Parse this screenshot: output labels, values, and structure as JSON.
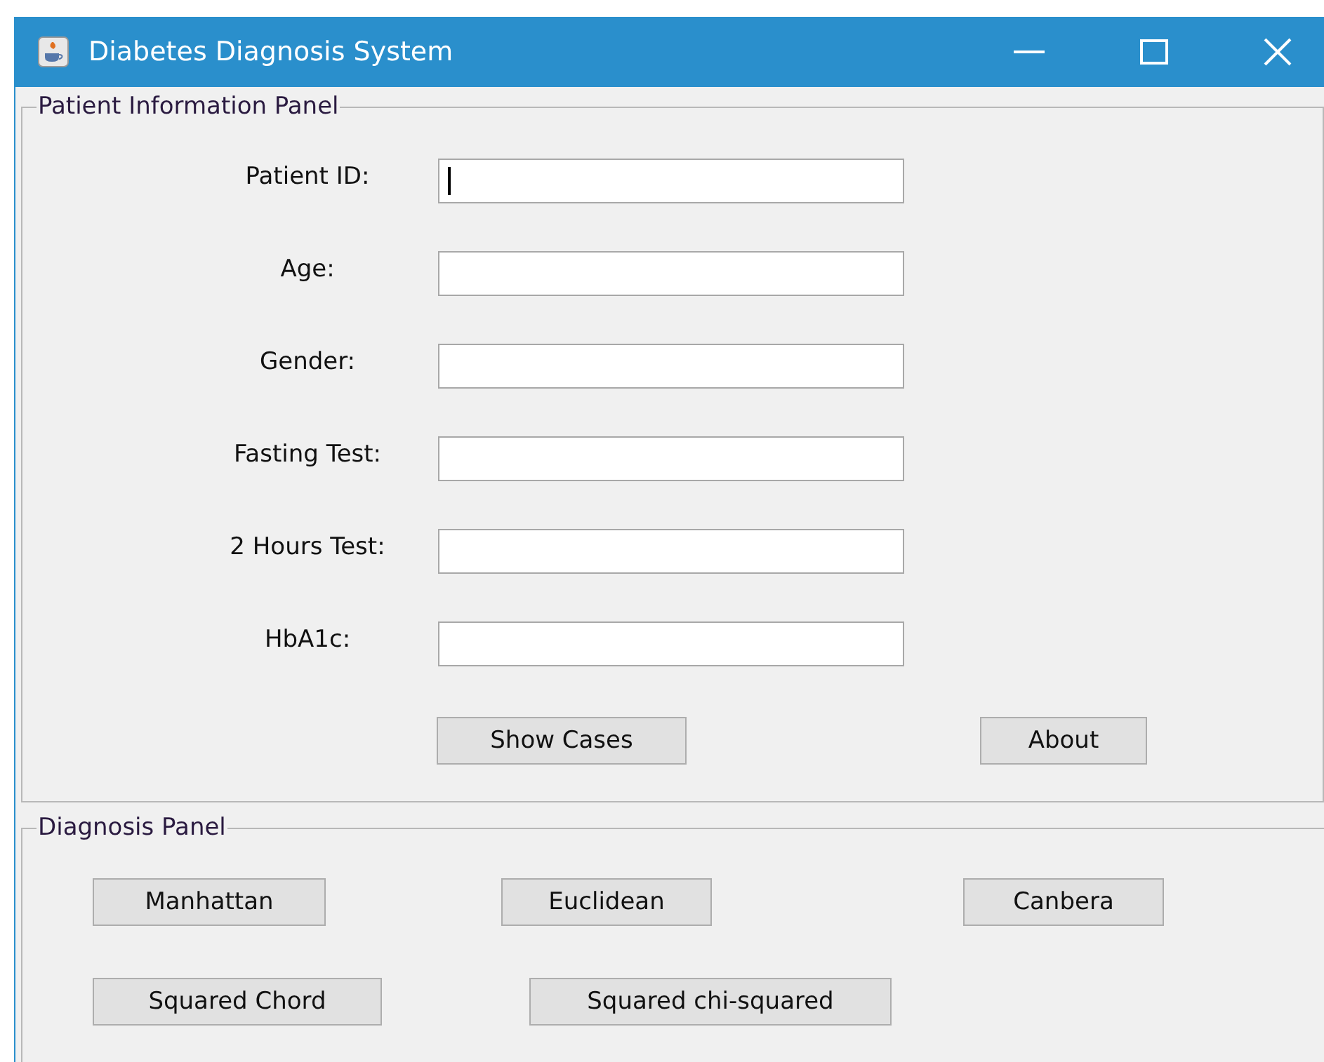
{
  "window": {
    "title": "Diabetes Diagnosis System"
  },
  "patient_panel": {
    "title": "Patient Information Panel",
    "fields": [
      {
        "label": "Patient ID:",
        "focused": true
      },
      {
        "label": "Age:",
        "focused": false
      },
      {
        "label": "Gender:",
        "focused": false
      },
      {
        "label": "Fasting Test:",
        "focused": false
      },
      {
        "label": "2 Hours Test:",
        "focused": false
      },
      {
        "label": "HbA1c:",
        "focused": false
      }
    ],
    "buttons": [
      "Show Cases",
      "About"
    ]
  },
  "diagnosis_panel": {
    "title": "Diagnosis Panel",
    "button_rows": [
      [
        "Manhattan",
        "Euclidean",
        "Canbera"
      ],
      [
        "Squared Chord",
        "Squared chi-squared"
      ]
    ]
  }
}
